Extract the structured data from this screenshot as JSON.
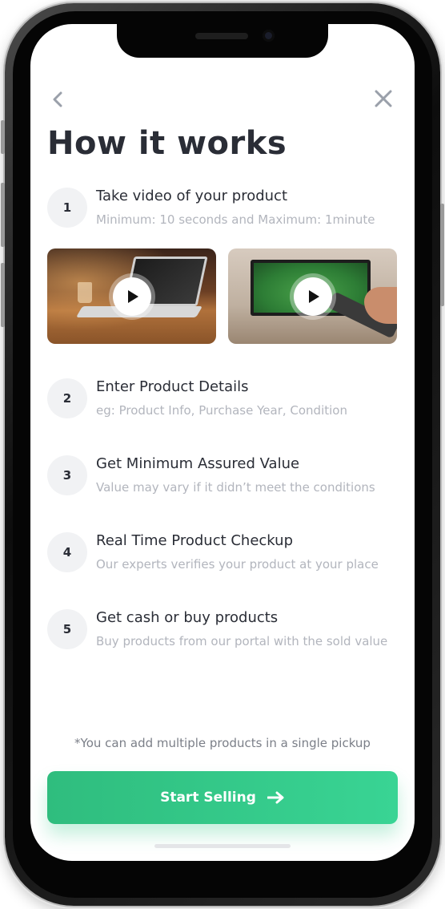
{
  "header": {
    "back_icon": "chevron-left-icon",
    "close_icon": "close-icon",
    "title": "How it works"
  },
  "steps": [
    {
      "number": "1",
      "title": "Take video of your product",
      "subtitle": "Minimum: 10 seconds and Maximum: 1minute"
    },
    {
      "number": "2",
      "title": "Enter Product Details",
      "subtitle": "eg: Product Info, Purchase Year, Condition"
    },
    {
      "number": "3",
      "title": "Get Minimum Assured Value",
      "subtitle": "Value may vary if it didn’t meet the conditions"
    },
    {
      "number": "4",
      "title": "Real Time Product Checkup",
      "subtitle": "Our experts verifies your product at your place"
    },
    {
      "number": "5",
      "title": "Get cash or buy products",
      "subtitle": "Buy products from our portal with the sold value"
    }
  ],
  "videos": [
    {
      "subject": "laptop",
      "icon": "play-icon"
    },
    {
      "subject": "tv",
      "icon": "play-icon"
    }
  ],
  "note": "*You can add multiple products in a single pickup",
  "cta": {
    "label": "Start Selling",
    "icon": "arrow-right-icon"
  },
  "colors": {
    "accent_start": "#2fbd7e",
    "accent_end": "#39d494",
    "title": "#2a2d36",
    "subtitle": "#b2b5bd",
    "badge_bg": "#f1f2f4"
  }
}
